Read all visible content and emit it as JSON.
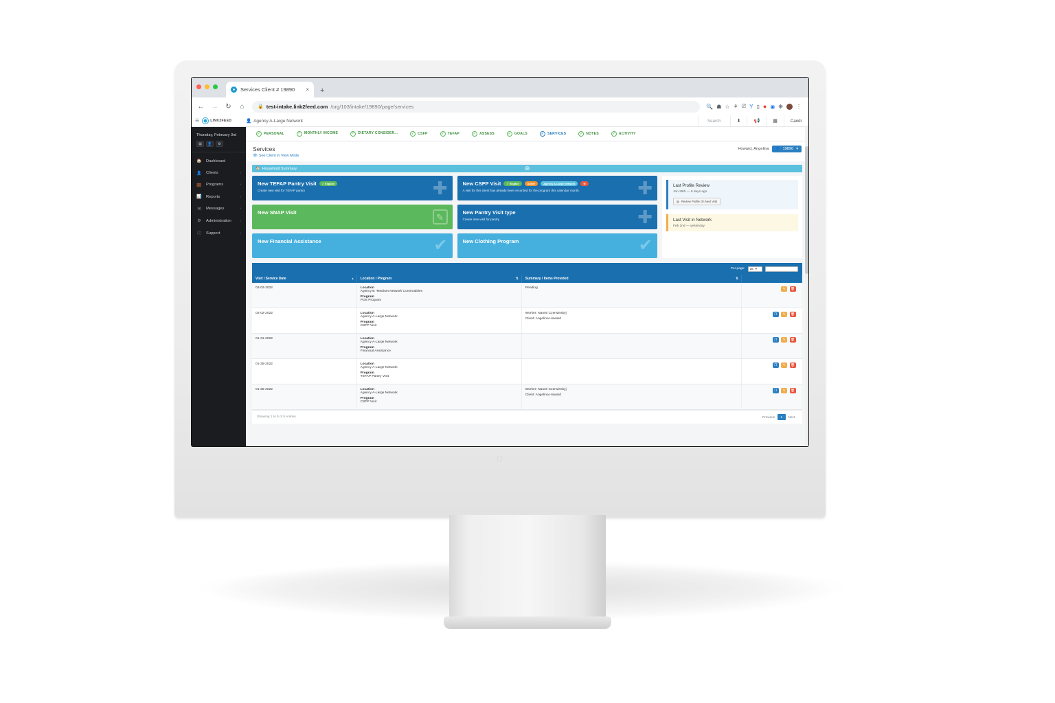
{
  "browser": {
    "tab_title": "Services Client # 19890",
    "tab_close": "×",
    "new_tab": "+",
    "url_domain": "test-intake.link2feed.com",
    "url_path": "/org/103/intake/19890/page/services",
    "back_icon": "←",
    "forward_icon": "→",
    "reload_icon": "↻",
    "home_icon": "⌂",
    "lock_icon": "ὑ2",
    "ext_icons": [
      "search-icon",
      "home-icon",
      "star-icon",
      "shield-icon",
      "capture-icon",
      "y-icon",
      "note-icon",
      "opera-icon",
      "globe-icon",
      "puzzle-icon",
      "profile-avatar",
      "kebab-menu-icon"
    ]
  },
  "topbar": {
    "menu_toggle_icon": "▤",
    "logo_text": "LINK2FEED",
    "agency": "Agency A-Large Network",
    "search_placeholder": "Search",
    "actions": [
      "download-icon",
      "megaphone-icon",
      "grid-icon"
    ],
    "user": "Candi"
  },
  "sidebar": {
    "date": "Thursday, February 3rd",
    "chips": [
      "calendar-chip",
      "user-chip",
      "gear-chip"
    ],
    "items": [
      {
        "label": "Dashboard",
        "icon": "home-icon",
        "caret": ""
      },
      {
        "label": "Clients",
        "icon": "user-icon",
        "caret": "›"
      },
      {
        "label": "Programs",
        "icon": "briefcase-icon",
        "caret": "›"
      },
      {
        "label": "Reports",
        "icon": "chart-icon",
        "caret": "›"
      },
      {
        "label": "Messages",
        "icon": "envelope-icon",
        "caret": "›"
      },
      {
        "label": "Administration",
        "icon": "cogs-icon",
        "caret": "›"
      },
      {
        "label": "Support",
        "icon": "info-icon",
        "caret": "›"
      }
    ]
  },
  "wizard": {
    "steps": [
      {
        "label": "PERSONAL",
        "active": false
      },
      {
        "label": "MONTHLY INCOME",
        "active": false
      },
      {
        "label": "DIETARY CONSIDER...",
        "active": false
      },
      {
        "label": "CSFP",
        "active": false
      },
      {
        "label": "TEFAP",
        "active": false
      },
      {
        "label": "ASSESS",
        "active": false
      },
      {
        "label": "GOALS",
        "active": false
      },
      {
        "label": "SERVICES",
        "active": true
      },
      {
        "label": "NOTES",
        "active": false
      },
      {
        "label": "ACTIVITY",
        "active": false
      }
    ]
  },
  "page": {
    "title": "Services",
    "subtitle": "See Client in View Mode",
    "client_name": "Howard, Angelina",
    "client_id": "19890",
    "client_caret": "▾",
    "household_summary": "Household Summary",
    "household_icon": "home-icon",
    "household_mid_icon": "print-icon"
  },
  "cards": [
    {
      "title": "New TEFAP Pantry Visit",
      "subtitle": "Create new visit for TEFAP pantry",
      "style": "blue",
      "icon": "plus-icon",
      "badges": [
        {
          "text": "✓ Eligible",
          "color": "green"
        }
      ]
    },
    {
      "title": "New CSFP Visit",
      "subtitle": "A visit for this client has already been recorded for the program this calendar month.",
      "style": "blue",
      "icon": "plus-icon",
      "badges": [
        {
          "text": "✓ Eligible",
          "color": "green"
        },
        {
          "text": "Active",
          "color": "orange"
        },
        {
          "text": "Agency A-Large Network",
          "color": "lblue"
        },
        {
          "text": "⊝",
          "color": "red"
        }
      ]
    },
    {
      "title": "New SNAP Visit",
      "subtitle": "",
      "style": "green",
      "icon": "pencil-box-icon",
      "badges": []
    },
    {
      "title": "New Pantry Visit type",
      "subtitle": "Create new visit for pantry",
      "style": "blue",
      "icon": "plus-icon",
      "badges": []
    },
    {
      "title": "New Financial Assistance",
      "subtitle": "",
      "style": "lightblue",
      "icon": "check-icon",
      "badges": []
    },
    {
      "title": "New Clothing Program",
      "subtitle": "",
      "style": "lightblue",
      "icon": "check-icon",
      "badges": []
    }
  ],
  "side_panels": [
    {
      "heading": "Last Profile Review",
      "text": "Jan 25th — 9 days ago",
      "button": "Review Profile On Next Visit",
      "button_icon": "calendar-icon",
      "style": "info"
    },
    {
      "heading": "Last Visit in Network",
      "text": "Feb 2nd — yesterday",
      "button": "",
      "button_icon": "",
      "style": "warn"
    }
  ],
  "table": {
    "per_page_label": "Per page:",
    "per_page_value": "25",
    "per_page_caret": "▾",
    "search_value": "",
    "columns": [
      {
        "label": "Visit / Service Date",
        "sort": "▴"
      },
      {
        "label": "Location / Program",
        "sort": "⇅"
      },
      {
        "label": "Summary / Items Provided",
        "sort": "⇅"
      },
      {
        "label": "",
        "sort": ""
      }
    ],
    "location_label": "Location",
    "program_label": "Program",
    "rows": [
      {
        "date": "02-02-2022",
        "location": "Agency B -Medium Network Commodities",
        "program": "POS Program",
        "summary_lines": [
          "Pending"
        ],
        "actions": [
          "edit",
          "delete"
        ]
      },
      {
        "date": "02-02-2022",
        "location": "Agency A-Large Network",
        "program": "CSFP Visit",
        "summary_lines": [
          "Worker: Naomi Czerwinskyj",
          "Client: Angelina Howard"
        ],
        "actions": [
          "copy",
          "edit",
          "delete"
        ]
      },
      {
        "date": "01-31-2022",
        "location": "Agency A-Large Network",
        "program": "Financial Assistance",
        "summary_lines": [],
        "actions": [
          "copy",
          "edit",
          "delete"
        ]
      },
      {
        "date": "01-25-2022",
        "location": "Agency A-Large Network",
        "program": "TEFAP Pantry Visit",
        "summary_lines": [],
        "actions": [
          "copy",
          "edit",
          "delete"
        ]
      },
      {
        "date": "01-25-2022",
        "location": "Agency A-Large Network",
        "program": "CSFP Visit",
        "summary_lines": [
          "Worker: Naomi Czerwinskyj",
          "Client: Angelina Howard"
        ],
        "actions": [
          "copy",
          "edit",
          "delete"
        ]
      }
    ],
    "footer_info": "Showing 1 to 5 of 5 entries",
    "pager": {
      "previous": "Previous",
      "current": "1",
      "next": "Next"
    }
  },
  "colors": {
    "primary_blue": "#1a6faf",
    "accent_blue": "#2a7fc1",
    "green": "#5cb85c",
    "light_blue": "#45b0de",
    "orange": "#f0ad4e",
    "red": "#e9573f",
    "sidebar_bg": "#1b1c20"
  }
}
